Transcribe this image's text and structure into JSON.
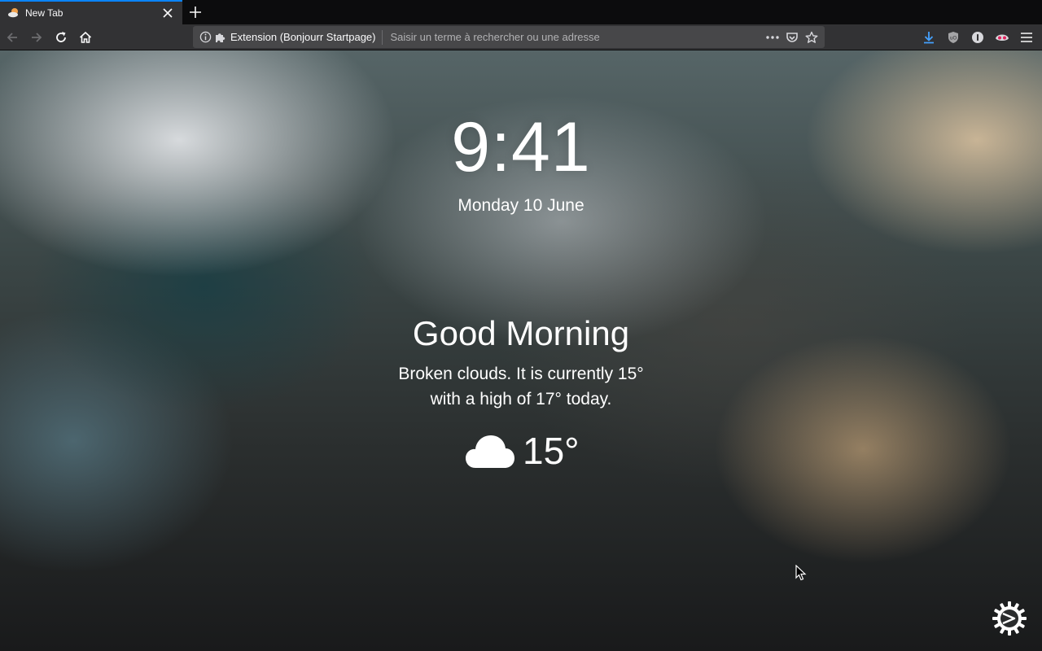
{
  "browser": {
    "tab": {
      "title": "New Tab",
      "favicon": "bonjourr-favicon-icon"
    },
    "urlbar": {
      "identity_label": "Extension (Bonjourr Startpage)",
      "placeholder": "Saisir un terme à rechercher ou une adresse"
    },
    "icons": [
      "back-icon",
      "forward-icon",
      "reload-icon",
      "home-icon",
      "info-icon",
      "puzzle-icon",
      "more-icon",
      "pocket-icon",
      "bookmark-star-icon",
      "download-icon",
      "ublock-icon",
      "onepassword-icon",
      "privacy-badger-icon",
      "menu-icon"
    ],
    "accent": "#0a84ff"
  },
  "page": {
    "time": "9:41",
    "date": "Monday 10 June",
    "greeting": "Good Morning",
    "description_line1": "Broken clouds. It is currently 15°",
    "description_line2": "with a high of 17° today.",
    "weather": {
      "icon": "cloud-icon",
      "temperature": "15°"
    },
    "settings_icon": "gear-icon"
  }
}
